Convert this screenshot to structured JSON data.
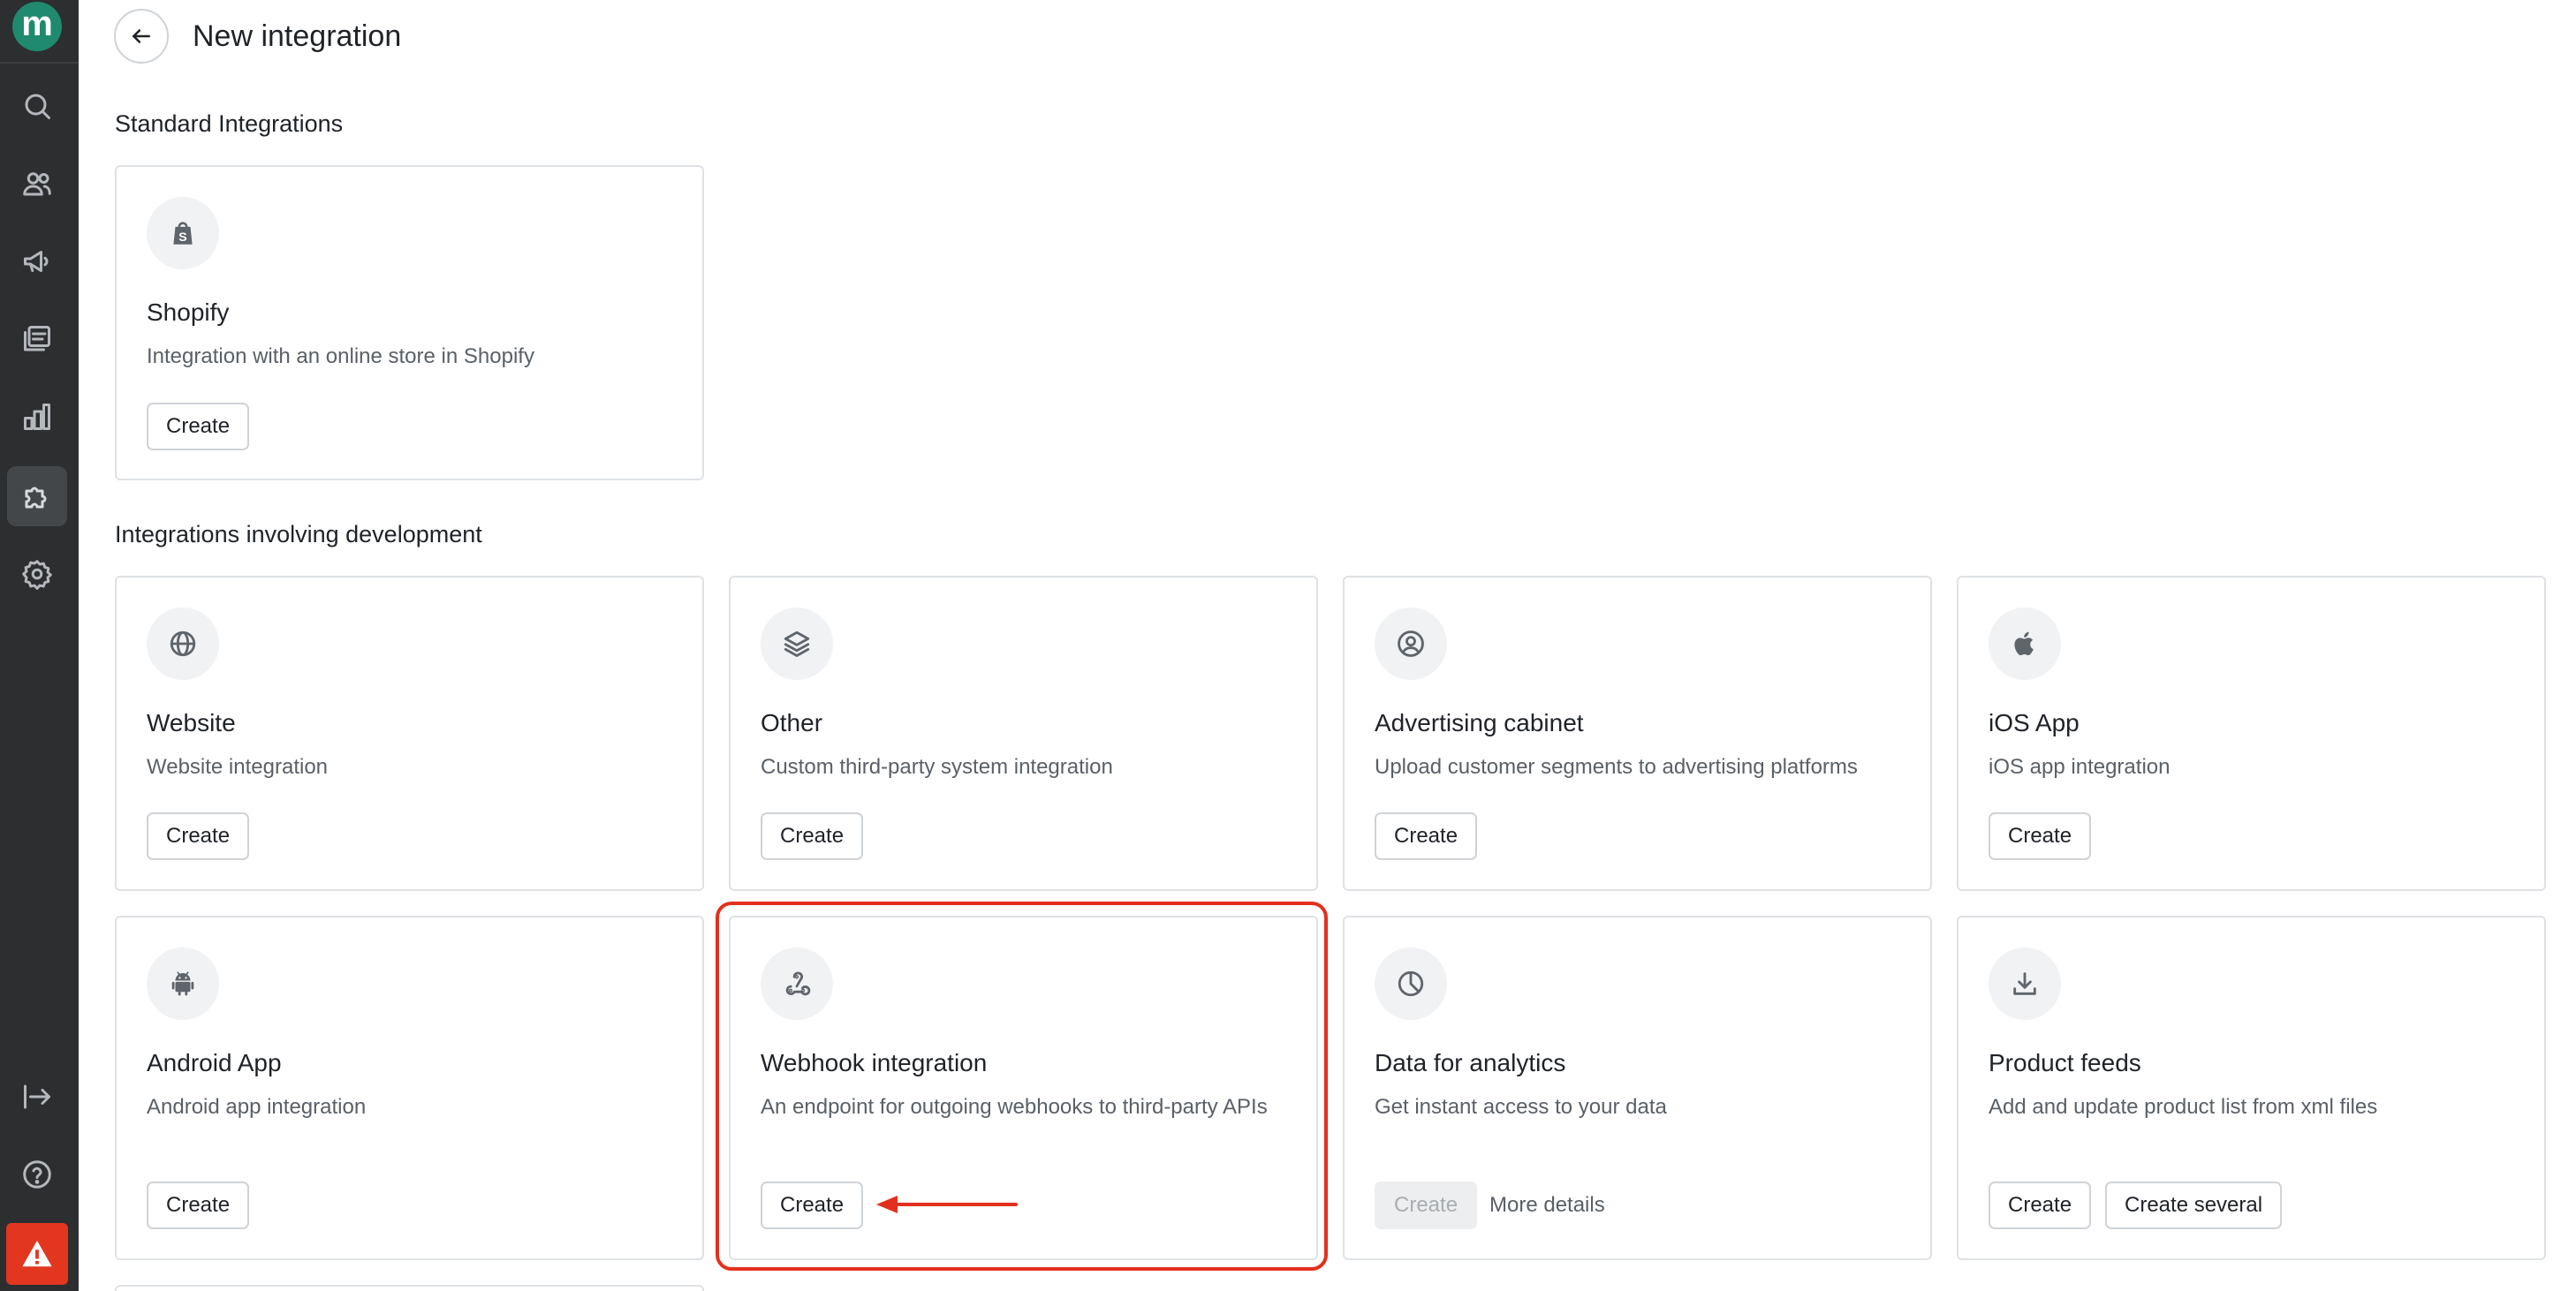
{
  "app": {
    "logo_letter": "m"
  },
  "sidebar": {
    "items": [
      {
        "name": "search-icon"
      },
      {
        "name": "users-icon"
      },
      {
        "name": "megaphone-icon"
      },
      {
        "name": "messages-icon"
      },
      {
        "name": "analytics-icon"
      },
      {
        "name": "puzzle-icon",
        "active": true
      },
      {
        "name": "gear-icon"
      }
    ],
    "bottom": [
      {
        "name": "expand-icon"
      },
      {
        "name": "help-icon"
      },
      {
        "name": "warning-icon",
        "color": "#e2361f"
      }
    ]
  },
  "header": {
    "title": "New integration"
  },
  "sections": {
    "standard": {
      "title": "Standard Integrations"
    },
    "development": {
      "title": "Integrations involving development"
    }
  },
  "cards": {
    "shopify": {
      "title": "Shopify",
      "description": "Integration with an online store in Shopify",
      "icon": "shopify-icon",
      "button": "Create"
    },
    "website": {
      "title": "Website",
      "description": "Website integration",
      "icon": "globe-icon",
      "button": "Create"
    },
    "other": {
      "title": "Other",
      "description": "Custom third-party system integration",
      "icon": "layers-icon",
      "button": "Create"
    },
    "advertising": {
      "title": "Advertising cabinet",
      "description": "Upload customer segments to advertising platforms",
      "icon": "user-circle-icon",
      "button": "Create"
    },
    "ios": {
      "title": "iOS App",
      "description": "iOS app integration",
      "icon": "apple-icon",
      "button": "Create"
    },
    "android": {
      "title": "Android App",
      "description": "Android app integration",
      "icon": "android-icon",
      "button": "Create"
    },
    "webhook": {
      "title": "Webhook integration",
      "description": "An endpoint for outgoing webhooks to third-party APIs",
      "icon": "webhook-icon",
      "button": "Create",
      "highlighted": true
    },
    "analytics": {
      "title": "Data for analytics",
      "description": "Get instant access to your data",
      "icon": "pie-chart-icon",
      "button": "Create",
      "button_disabled": true,
      "link": "More details"
    },
    "feeds": {
      "title": "Product feeds",
      "description": "Add and update product list from xml files",
      "icon": "download-icon",
      "button": "Create",
      "button_secondary": "Create several"
    }
  },
  "colors": {
    "accent": "#1f8a6d",
    "highlight": "#e3301e",
    "sidebar": "#2c2e30"
  }
}
